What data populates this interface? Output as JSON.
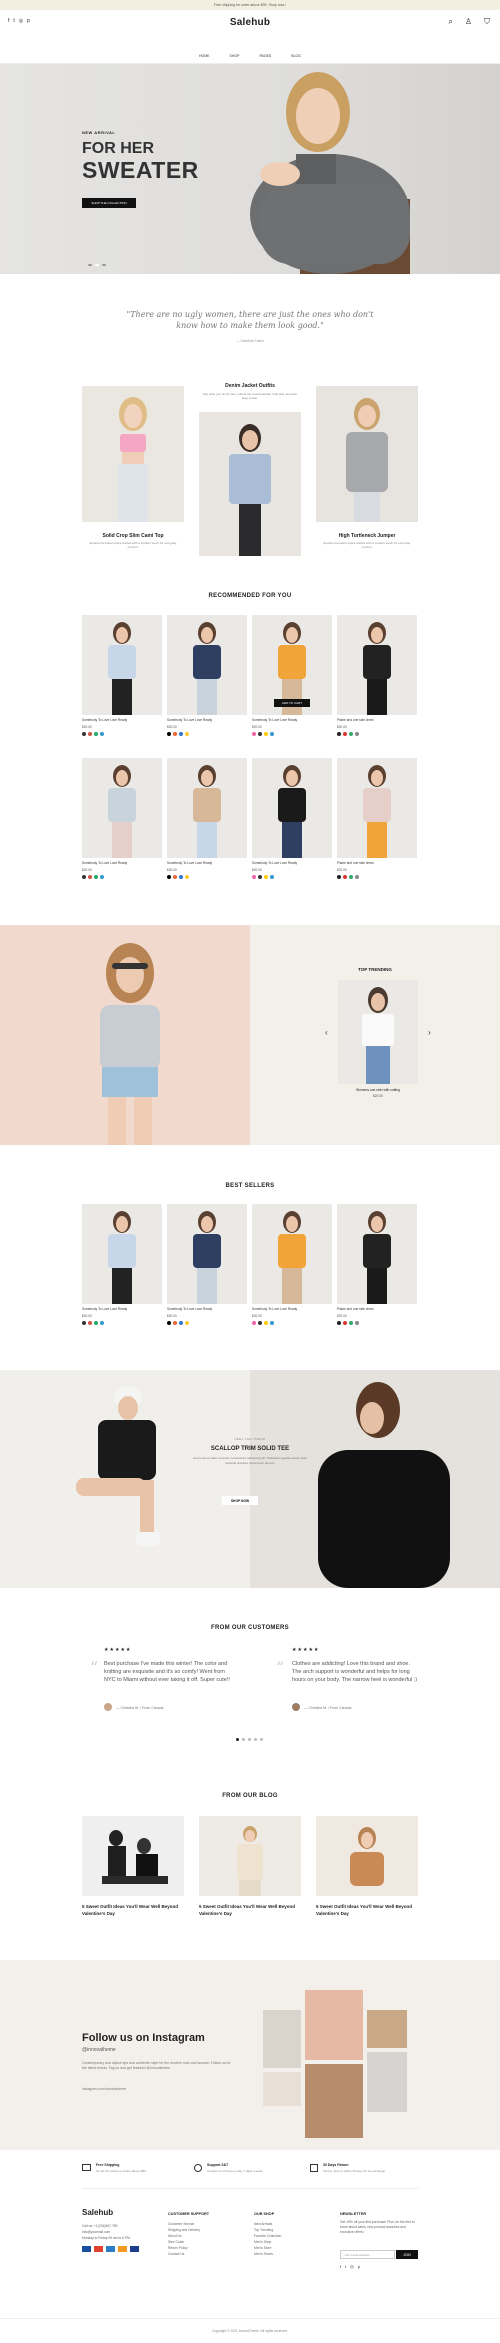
{
  "announcement": "Free shipping for order above $99. Shop now !",
  "social_icons": [
    "facebook-icon",
    "twitter-icon",
    "instagram-icon",
    "pinterest-icon"
  ],
  "logo": "Salehub",
  "nav": [
    "HOME",
    "SHOP",
    "PAGES",
    "BLOG"
  ],
  "hero": {
    "subtitle": "NEW ARRIVAL",
    "title_line1": "FOR HER",
    "title_line2": "SWEATER",
    "button": "SHOP THE COLLECTION"
  },
  "quote": {
    "text": "\"There are no ugly women, there are just the ones who don't know how to make them look good.\"",
    "author": "— Gabriela Failon"
  },
  "lookbook": {
    "center_title": "Denim Jacket Outfits",
    "center_text": "Say what you do for own, submit the most beautiful, final pick, and also keep a step.",
    "left_title": "Solid Crop Slim Cami Top",
    "left_text": "Explore the latest styles crafted with a modern touch for everyday comfort.",
    "right_title": "High Turtleneck Jumper",
    "right_text": "Explore the latest styles crafted with a modern touch for everyday comfort."
  },
  "recommended": {
    "title": "RECOMMENDED FOR YOU",
    "add_to_cart": "ADD TO CART",
    "products": [
      {
        "name": "Somebody To Love Love Ready",
        "price": "$20.00"
      },
      {
        "name": "Somebody To Love Love Ready",
        "price": "$20.00"
      },
      {
        "name": "Somebody To Love Love Ready",
        "price": "$20.00"
      },
      {
        "name": "Plaine and one side chest",
        "price": "$20.00"
      },
      {
        "name": "Somebody To Love Love Ready",
        "price": "$20.00"
      },
      {
        "name": "Somebody To Love Love Ready",
        "price": "$20.00"
      },
      {
        "name": "Somebody To Love Love Ready",
        "price": "$20.00"
      },
      {
        "name": "Plaine and one side chest",
        "price": "$20.00"
      }
    ]
  },
  "trending": {
    "title": "TOP TRENDING",
    "product": "Womens one shirt with cutting",
    "price": "$20.00"
  },
  "bestsellers": {
    "title": "BEST SELLERS",
    "products": [
      {
        "name": "Somebody To Love Love Ready",
        "price": "$20.00"
      },
      {
        "name": "Somebody To Love Love Ready",
        "price": "$20.00"
      },
      {
        "name": "Somebody To Love Love Ready",
        "price": "$20.00"
      },
      {
        "name": "Plaine and one side chest",
        "price": "$20.00"
      }
    ]
  },
  "promo": {
    "kicker": "FEEL THE TREND",
    "title": "SCALLOP TRIM SOLID TEE",
    "text": "Lorem ipsum dolor sit amet, consectetur adipiscing elit. Phasellus egestas ipsum justo vehicula tincidunt porta lorem tempor.",
    "button": "SHOP NOW"
  },
  "customers": {
    "title": "FROM OUR CUSTOMERS",
    "reviews": [
      {
        "stars": "★★★★★",
        "text": "Best purchase I've made this winter! The color and knitting are exquisite and it's so comfy! Went from NYC to Miami without ever taking it off. Super cute!!",
        "author": "— Christina M. / From Canada"
      },
      {
        "stars": "★★★★★",
        "text": "Clothes are addicting! Love this brand and shoe. The arch support is wonderful and helps for long hours on your body. The narrow heel is wonderful :)",
        "author": "— Christina M. / From Canada"
      }
    ]
  },
  "blog": {
    "title": "FROM OUR BLOG",
    "posts": [
      "5 Sweet Outfit Ideas You'll Wear Well Beyond Valentine's Day",
      "5 Sweet Outfit Ideas You'll Wear Well Beyond Valentine's Day",
      "5 Sweet Outfit Ideas You'll Wear Well Beyond Valentine's Day"
    ]
  },
  "instagram": {
    "heading": "Follow us on Instagram",
    "handle": "@innovatheme",
    "text": "Contemporary and stylish tips and authentic style for the modern man and woman. Follow us for the latest trends. Tag us and get featured @innovatheme",
    "link": "instagram.com/innovatheme"
  },
  "features": [
    {
      "title": "Free Shipping",
      "sub": "On all UK orders or orders above $99"
    },
    {
      "title": "Support 24/7",
      "sub": "Contact us 24 hours a day, 7 days a week"
    },
    {
      "title": "30 Days Return",
      "sub": "Simply return it within 30 days for an exchange"
    }
  ],
  "footer": {
    "logo": "Salehub",
    "contact": [
      "Call us: +1(234)567-789",
      "info@yourmail.com",
      "Monday to Friday 09 am to 6 PM"
    ],
    "col2_title": "CUSTOMER SUPPORT",
    "col2_links": [
      "Customer Service",
      "Shipping and Delivery",
      "About Us",
      "Size Guide",
      "Return Policy",
      "Contact Us"
    ],
    "col3_title": "OUR SHOP",
    "col3_links": [
      "New Arrivals",
      "Top Trending",
      "Favorite Collection",
      "Men's Shop",
      "Men's Store",
      "Men's Shoes"
    ],
    "col4_title": "NEWSLETTER",
    "col4_text": "Get 15% off your first purchase! Plus, be the first to know about sales, new product launches and exclusive offers!",
    "email_placeholder": "Your email address",
    "join": "JOIN"
  },
  "copyright": "Copyright © 2021 InnovaTheme. All rights reserved."
}
